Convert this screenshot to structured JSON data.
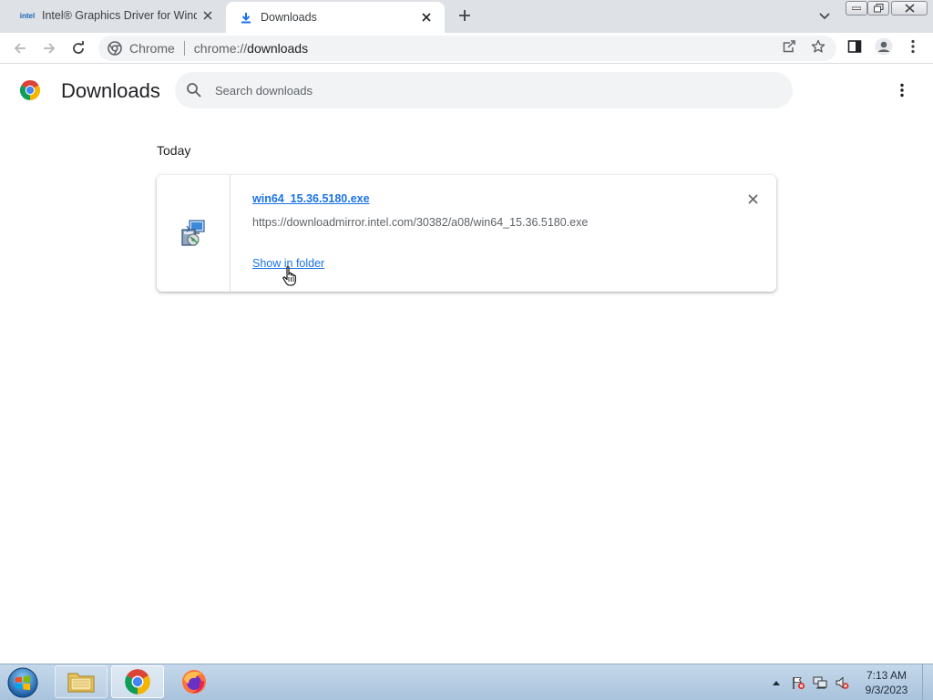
{
  "window": {
    "title": "Downloads"
  },
  "tabs": [
    {
      "label": "Intel® Graphics Driver for Windows",
      "favicon": "intel-logo",
      "favicon_text": "intel",
      "active": false
    },
    {
      "label": "Downloads",
      "favicon": "download-icon",
      "active": true
    }
  ],
  "toolbar": {
    "omnibox_chip": "Chrome",
    "url_scheme": "chrome://",
    "url_host": "downloads"
  },
  "downloads_page": {
    "title": "Downloads",
    "search_placeholder": "Search downloads",
    "search_value": "",
    "groups": [
      {
        "label": "Today",
        "items": [
          {
            "file_name": "win64_15.36.5180.exe",
            "url": "https://downloadmirror.intel.com/30382/a08/win64_15.36.5180.exe",
            "action_label": "Show in folder",
            "icon": "installer-icon"
          }
        ]
      }
    ]
  },
  "taskbar": {
    "pinned": [
      "windows-explorer",
      "google-chrome",
      "firefox"
    ],
    "clock_time": "7:13 AM",
    "clock_date": "9/3/2023"
  },
  "colors": {
    "accent": "#1a73e8",
    "tabstrip": "#dee1e6",
    "omnibox": "#f1f3f4"
  }
}
